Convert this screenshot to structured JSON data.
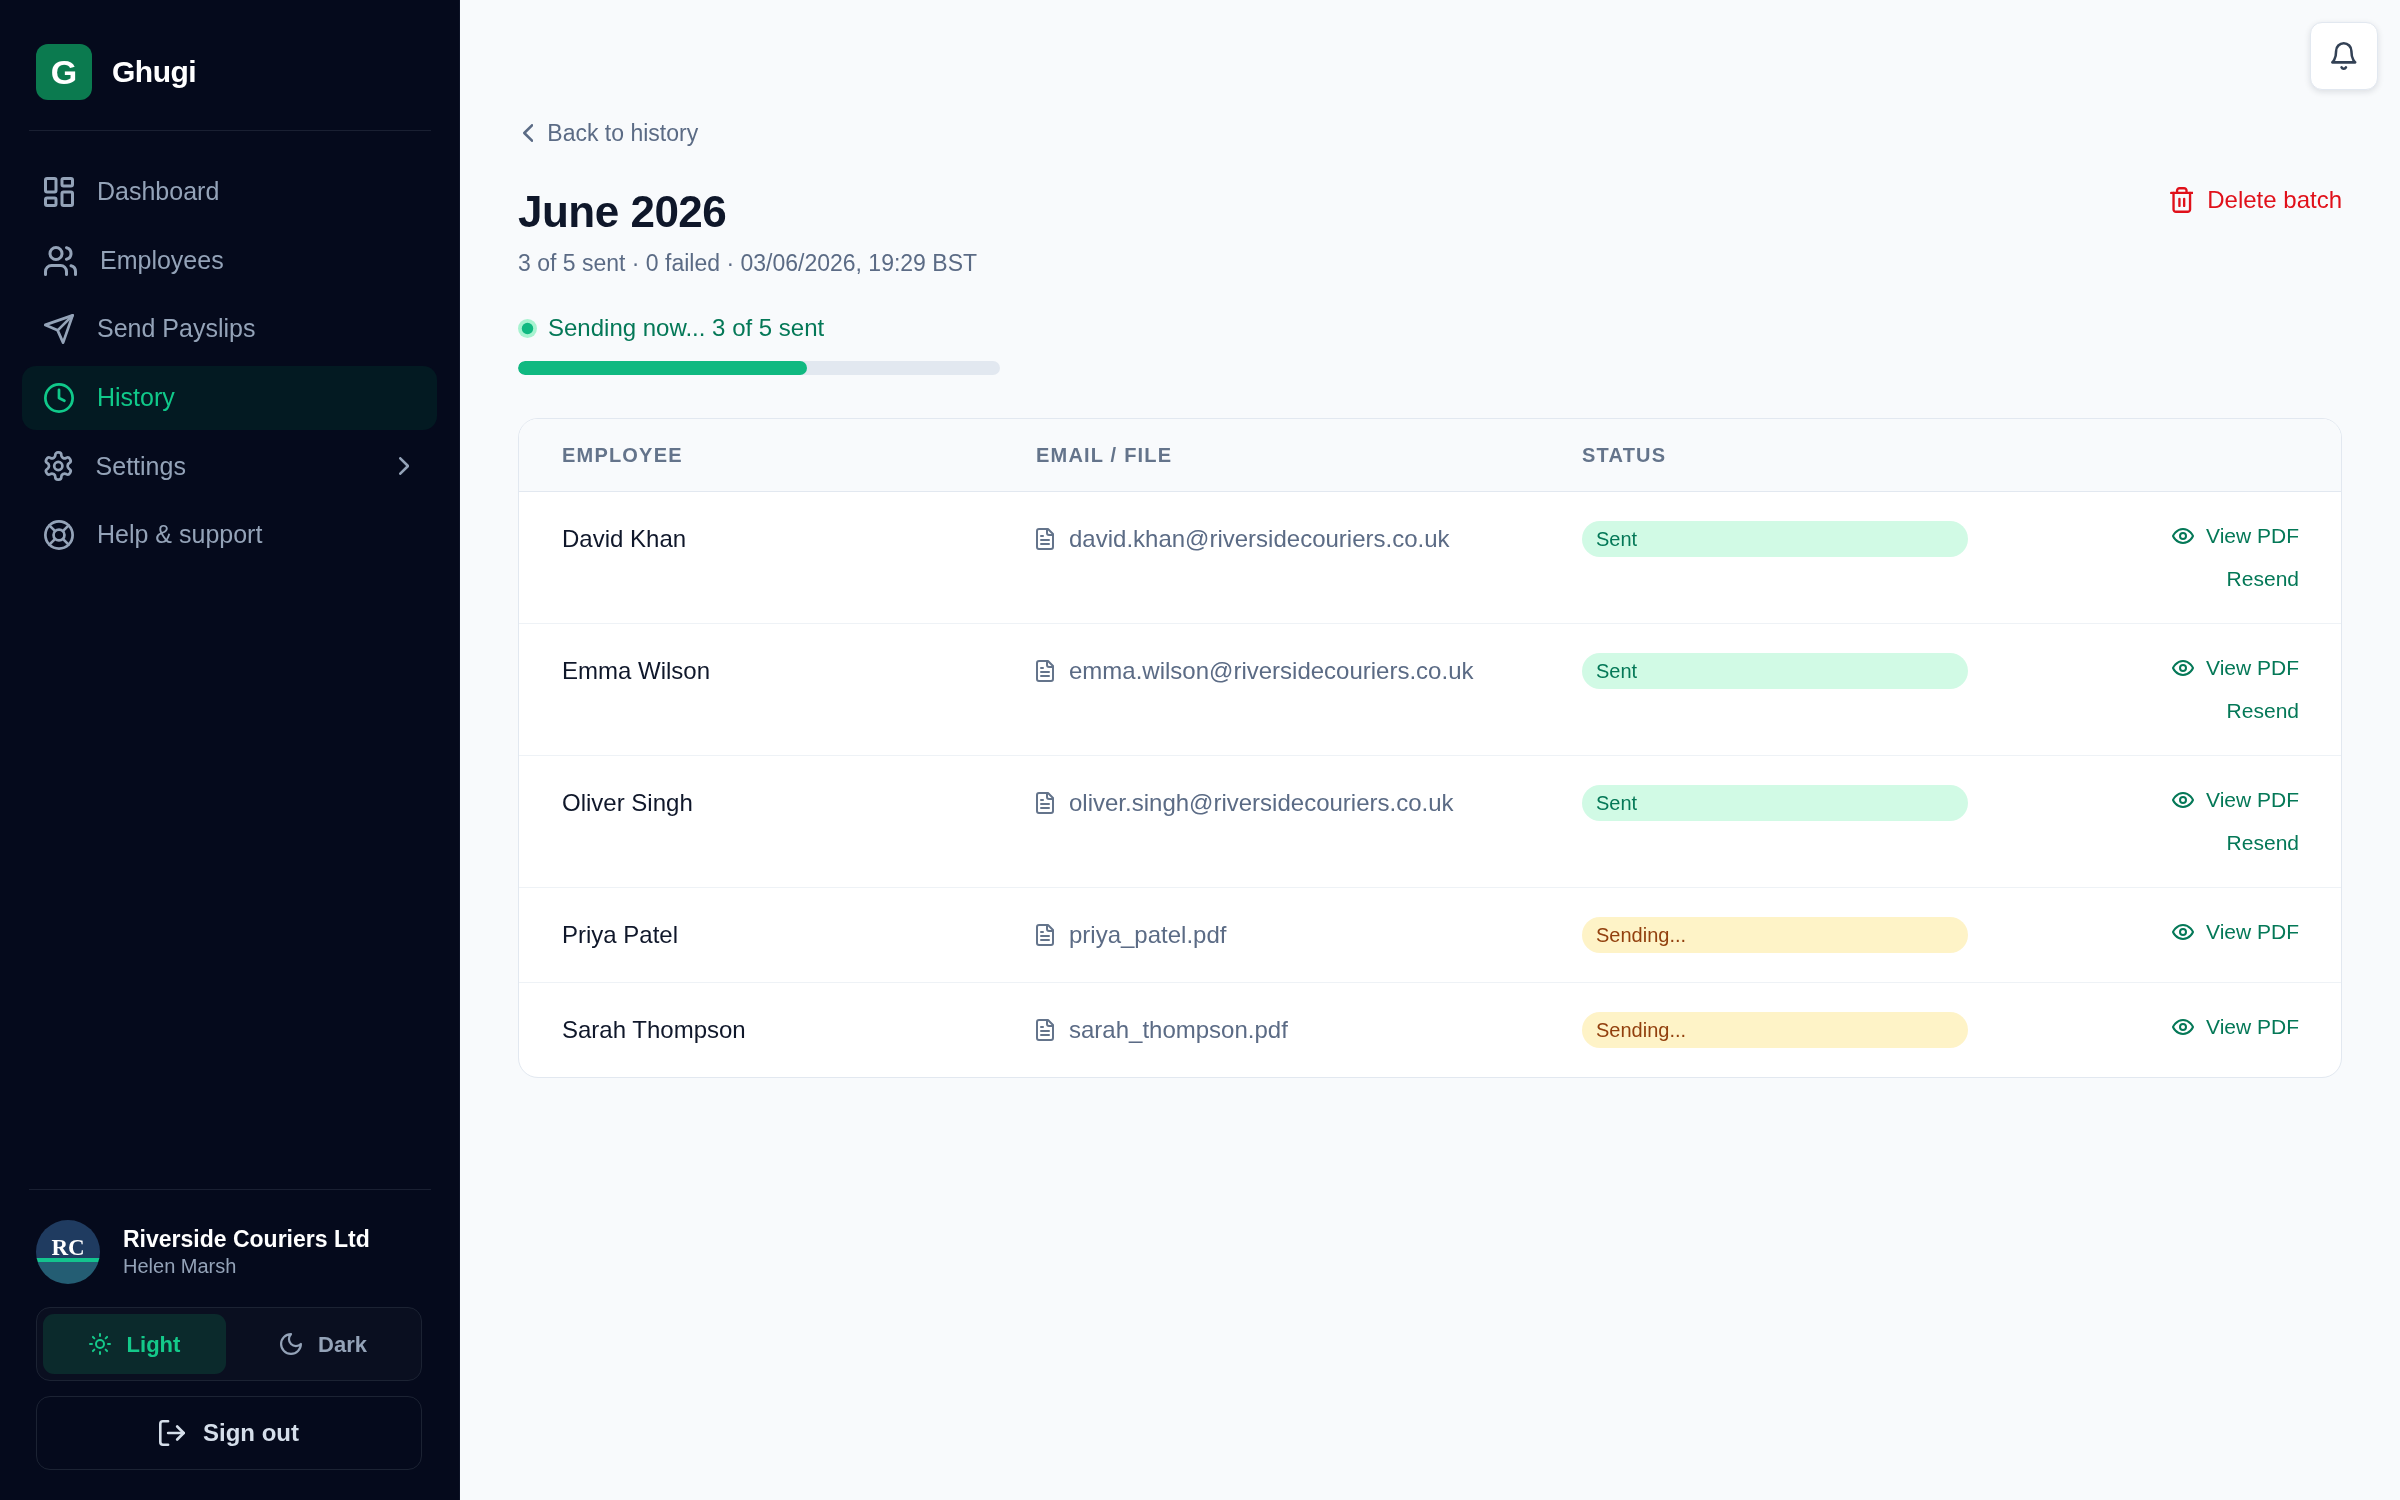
{
  "sidebar": {
    "logo_letter": "G",
    "app_name": "Ghugi",
    "nav": [
      {
        "label": "Dashboard",
        "kind": "link",
        "selected": false
      },
      {
        "label": "Employees",
        "kind": "link",
        "selected": false
      },
      {
        "label": "Send Payslips",
        "kind": "link",
        "selected": false
      },
      {
        "label": "History",
        "kind": "link",
        "selected": true
      },
      {
        "label": "Settings",
        "kind": "group",
        "selected": false
      },
      {
        "label": "Help & support",
        "kind": "link",
        "selected": false
      }
    ],
    "account": {
      "initials": "RC",
      "company": "Riverside Couriers Ltd",
      "user": "Helen Marsh"
    },
    "theme": [
      {
        "label": "Light",
        "selected": true
      },
      {
        "label": "Dark",
        "selected": false
      }
    ],
    "sign_out": "Sign out"
  },
  "header": {
    "back": "Back to history",
    "title": "June 2026",
    "summary": "3 of 5 sent · 0 failed · 03/06/2026, 19:29 BST",
    "delete": "Delete batch"
  },
  "progress": {
    "label": "Sending now... 3 of 5 sent",
    "level": 0.6
  },
  "table": {
    "columns": [
      "EMPLOYEE",
      "EMAIL / FILE",
      "STATUS"
    ],
    "rows": [
      {
        "employee": "David Khan",
        "email_file": "david.khan@riversidecouriers.co.uk",
        "status": {
          "label": "Sent",
          "kind": "sent"
        },
        "actions": [
          {
            "kind": "view",
            "label": "View PDF"
          },
          {
            "kind": "resend",
            "label": "Resend"
          }
        ]
      },
      {
        "employee": "Emma Wilson",
        "email_file": "emma.wilson@riversidecouriers.co.uk",
        "status": {
          "label": "Sent",
          "kind": "sent"
        },
        "actions": [
          {
            "kind": "view",
            "label": "View PDF"
          },
          {
            "kind": "resend",
            "label": "Resend"
          }
        ]
      },
      {
        "employee": "Oliver Singh",
        "email_file": "oliver.singh@riversidecouriers.co.uk",
        "status": {
          "label": "Sent",
          "kind": "sent"
        },
        "actions": [
          {
            "kind": "view",
            "label": "View PDF"
          },
          {
            "kind": "resend",
            "label": "Resend"
          }
        ]
      },
      {
        "employee": "Priya Patel",
        "email_file": "priya_patel.pdf",
        "status": {
          "label": "Sending...",
          "kind": "sending"
        },
        "actions": [
          {
            "kind": "view",
            "label": "View PDF"
          }
        ]
      },
      {
        "employee": "Sarah Thompson",
        "email_file": "sarah_thompson.pdf",
        "status": {
          "label": "Sending...",
          "kind": "sending"
        },
        "actions": [
          {
            "kind": "view",
            "label": "View PDF"
          }
        ]
      }
    ]
  }
}
